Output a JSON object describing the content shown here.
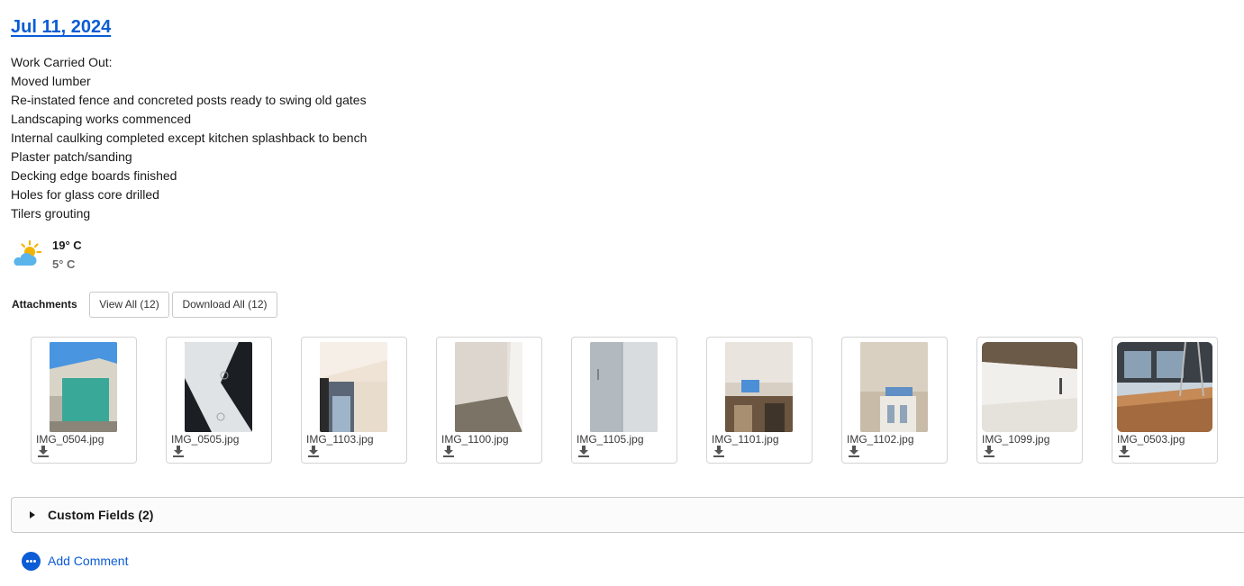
{
  "entry": {
    "date": "Jul 11, 2024",
    "notes": [
      "Work Carried Out:",
      "Moved lumber",
      "Re-instated fence and concreted posts ready to swing old gates",
      "Landscaping works commenced",
      "Internal caulking completed except kitchen splashback to bench",
      "Plaster patch/sanding",
      "Decking edge boards finished",
      "Holes for glass core drilled",
      "Tilers grouting"
    ]
  },
  "weather": {
    "icon": "partly-cloudy-icon",
    "high": "19° C",
    "low": "5° C"
  },
  "attachments": {
    "label": "Attachments",
    "view_all_label": "View All (12)",
    "download_all_label": "Download All (12)",
    "items": [
      {
        "filename": "IMG_0504.jpg"
      },
      {
        "filename": "IMG_0505.jpg"
      },
      {
        "filename": "IMG_1103.jpg"
      },
      {
        "filename": "IMG_1100.jpg"
      },
      {
        "filename": "IMG_1105.jpg"
      },
      {
        "filename": "IMG_1101.jpg"
      },
      {
        "filename": "IMG_1102.jpg"
      },
      {
        "filename": "IMG_1099.jpg"
      },
      {
        "filename": "IMG_0503.jpg"
      }
    ]
  },
  "custom_fields": {
    "label": "Custom Fields (2)"
  },
  "comment": {
    "label": "Add Comment"
  },
  "colors": {
    "link": "#0b5cd5",
    "border": "#d4d4d4"
  }
}
